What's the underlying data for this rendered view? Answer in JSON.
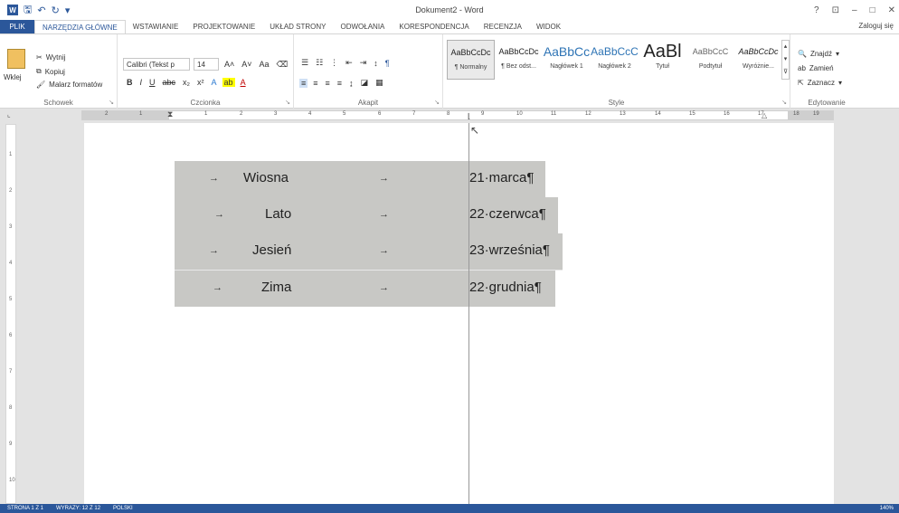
{
  "window": {
    "title": "Dokument2 - Word",
    "controls": [
      "?",
      "⊡",
      "–",
      "□",
      "✕"
    ]
  },
  "tabs": [
    {
      "label": "PLIK"
    },
    {
      "label": "NARZĘDZIA GŁÓWNE"
    },
    {
      "label": "WSTAWIANIE"
    },
    {
      "label": "PROJEKTOWANIE"
    },
    {
      "label": "UKŁAD STRONY"
    },
    {
      "label": "ODWOŁANIA"
    },
    {
      "label": "KORESPONDENCJA"
    },
    {
      "label": "RECENZJA"
    },
    {
      "label": "WIDOK"
    }
  ],
  "signin": "Zaloguj się",
  "ribbon": {
    "clipboard": {
      "paste": "Wklej",
      "cut": "Wytnij",
      "copy": "Kopiuj",
      "painter": "Malarz formatów",
      "label": "Schowek"
    },
    "font": {
      "name": "Calibri (Tekst p",
      "size": "14",
      "label": "Czcionka"
    },
    "paragraph": {
      "label": "Akapit"
    },
    "styles": {
      "items": [
        {
          "preview": "AaBbCcDc",
          "name": "¶ Normalny"
        },
        {
          "preview": "AaBbCcDc",
          "name": "¶ Bez odst..."
        },
        {
          "preview": "AaBbCc",
          "name": "Nagłówek 1"
        },
        {
          "preview": "AaBbCcC",
          "name": "Nagłówek 2"
        },
        {
          "preview": "AaBl",
          "name": "Tytuł"
        },
        {
          "preview": "AaBbCcC",
          "name": "Podtytuł"
        },
        {
          "preview": "AaBbCcDc",
          "name": "Wyróżnie..."
        }
      ],
      "label": "Style"
    },
    "editing": {
      "find": "Znajdź",
      "replace": "Zamień",
      "select": "Zaznacz",
      "label": "Edytowanie"
    }
  },
  "ruler": {
    "numbers": [
      "2",
      "1",
      "1",
      "2",
      "3",
      "4",
      "5",
      "6",
      "7",
      "8",
      "9",
      "10",
      "11",
      "12",
      "13",
      "14",
      "15",
      "16",
      "17",
      "18",
      "19"
    ],
    "vertical": [
      "1",
      "2",
      "3",
      "4",
      "5",
      "6",
      "7",
      "8",
      "9",
      "10"
    ]
  },
  "table": {
    "rows": [
      {
        "season": "Wiosna",
        "date": "21·marca¶"
      },
      {
        "season": "Lato",
        "date": "22·czerwca¶"
      },
      {
        "season": "Jesień",
        "date": "23·września¶"
      },
      {
        "season": "Zima",
        "date": "22·grudnia¶"
      }
    ],
    "tab_glyph": "→"
  },
  "status": {
    "page": "STRONA 1 Z 1",
    "words": "WYRAZY: 12 Z 12",
    "lang": "POLSKI",
    "zoom": "140%"
  },
  "colors": {
    "accent": "#2b579a",
    "selection": "#c8c8c5"
  }
}
